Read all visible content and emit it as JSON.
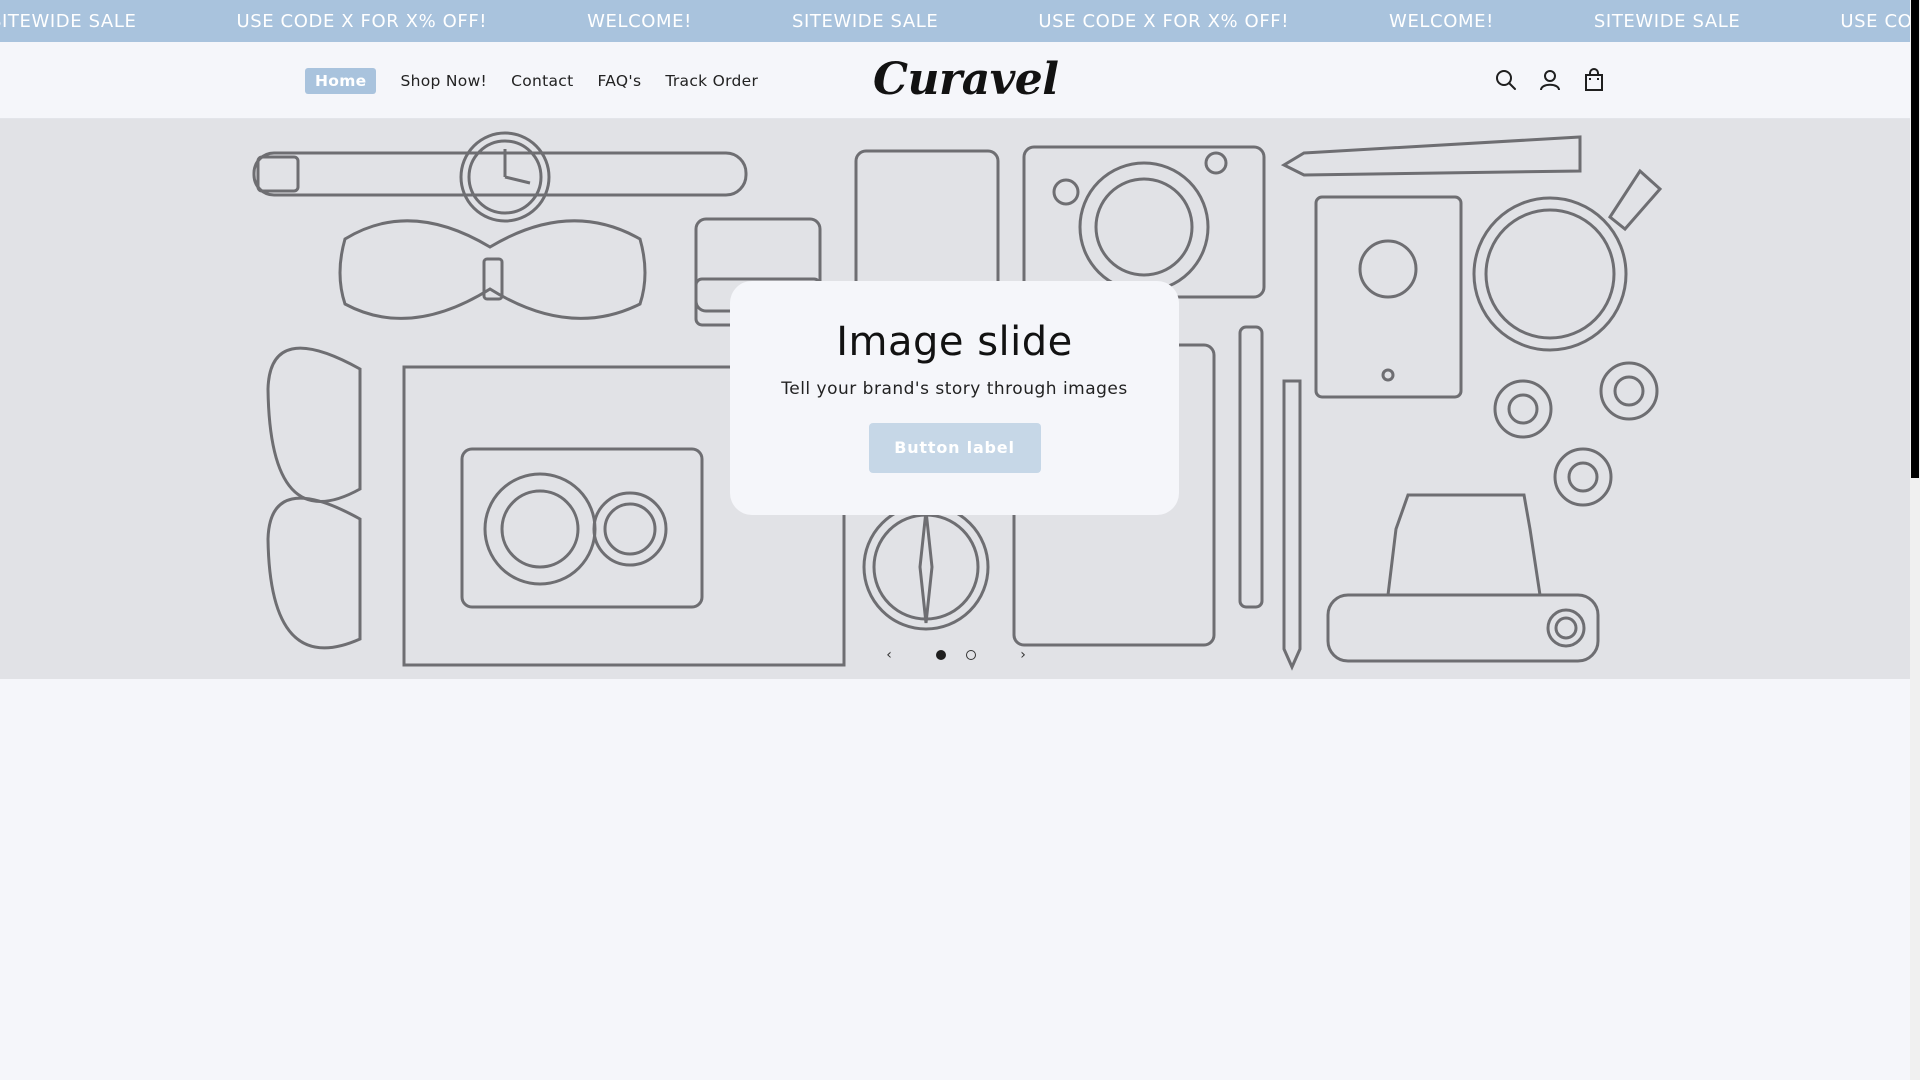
{
  "announcement": {
    "items": [
      "SITEWIDE SALE",
      "USE CODE X FOR X% OFF!",
      "WELCOME!",
      "SITEWIDE SALE",
      "USE CODE X FOR X% OFF!",
      "WELCOME!",
      "SITEWIDE SALE",
      "USE CODE X FOR X% OFF!"
    ]
  },
  "header": {
    "logo": "Curavel",
    "nav": [
      "Home",
      "Shop Now!",
      "Contact",
      "FAQ's",
      "Track Order"
    ],
    "icons": [
      "search-icon",
      "account-icon",
      "cart-icon"
    ]
  },
  "hero": {
    "title": "Image slide",
    "subtitle": "Tell your brand's story through images",
    "button_label": "Button label",
    "prev_symbol": "‹",
    "next_symbol": "›",
    "slide_count": 2,
    "active_slide": 1
  },
  "colors": {
    "accent": "#a9c3dd",
    "hero_bg": "#e1e2e6",
    "page_bg": "#f5f6fa",
    "button_bg": "#c6d7e7"
  }
}
